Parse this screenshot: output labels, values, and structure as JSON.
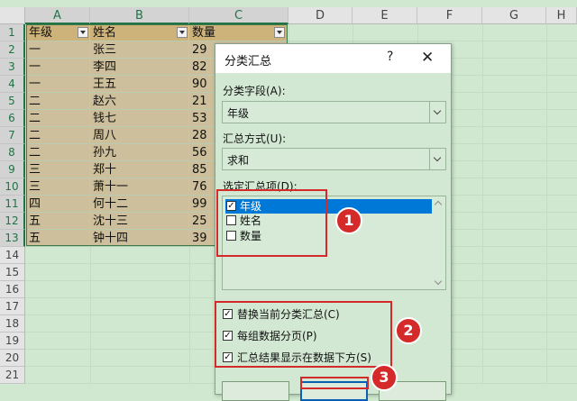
{
  "sheet": {
    "columns": [
      "A",
      "B",
      "C",
      "D",
      "E",
      "F",
      "G",
      "H"
    ],
    "rows": [
      "1",
      "2",
      "3",
      "4",
      "5",
      "6",
      "7",
      "8",
      "9",
      "10",
      "11",
      "12",
      "13",
      "14",
      "15",
      "16",
      "17",
      "18",
      "19",
      "20",
      "21"
    ],
    "headers": [
      "年级",
      "姓名",
      "数量"
    ],
    "data": [
      [
        "一",
        "张三",
        "29"
      ],
      [
        "一",
        "李四",
        "82"
      ],
      [
        "一",
        "王五",
        "90"
      ],
      [
        "二",
        "赵六",
        "21"
      ],
      [
        "二",
        "钱七",
        "53"
      ],
      [
        "二",
        "周八",
        "28"
      ],
      [
        "二",
        "孙九",
        "56"
      ],
      [
        "三",
        "郑十",
        "85"
      ],
      [
        "三",
        "萧十一",
        "76"
      ],
      [
        "四",
        "何十二",
        "99"
      ],
      [
        "五",
        "沈十三",
        "25"
      ],
      [
        "五",
        "钟十四",
        "39"
      ]
    ]
  },
  "dialog": {
    "title": "分类汇总",
    "help": "?",
    "close": "✕",
    "group_field_label": "分类字段(A):",
    "group_field_value": "年级",
    "function_label": "汇总方式(U):",
    "function_value": "求和",
    "items_label": "选定汇总项(D):",
    "items": [
      {
        "label": "年级",
        "checked": true,
        "selected": true
      },
      {
        "label": "姓名",
        "checked": false,
        "selected": false
      },
      {
        "label": "数量",
        "checked": false,
        "selected": false
      }
    ],
    "options": [
      {
        "label": "替换当前分类汇总(C)",
        "checked": true
      },
      {
        "label": "每组数据分页(P)",
        "checked": true
      },
      {
        "label": "汇总结果显示在数据下方(S)",
        "checked": true
      }
    ]
  },
  "annotations": [
    "1",
    "2",
    "3"
  ],
  "colors": {
    "annotation": "#d42a2a",
    "selection": "#0078d7",
    "sheet_bg": "#cfe8cf"
  }
}
